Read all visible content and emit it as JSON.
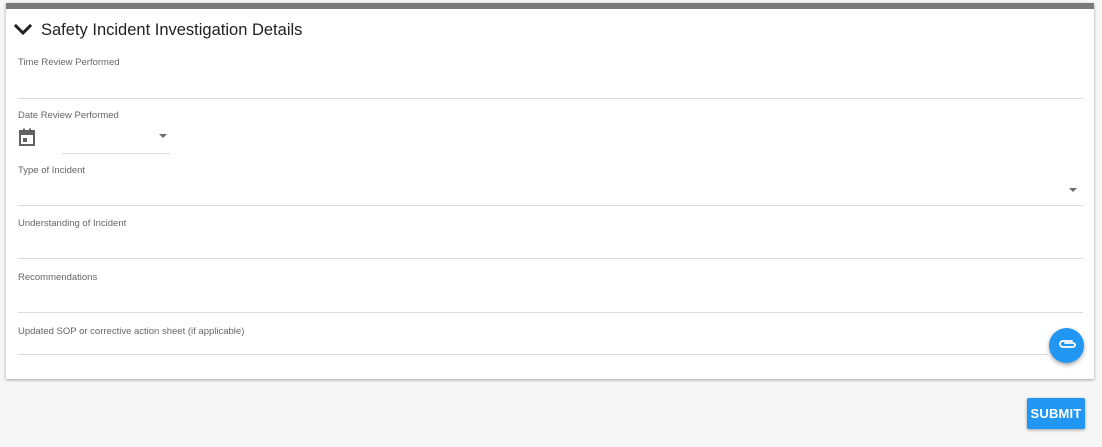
{
  "section": {
    "title": "Safety Incident Investigation Details",
    "expand_icon": "chevron-down-icon"
  },
  "fields": {
    "time_review": {
      "label": "Time Review Performed",
      "value": ""
    },
    "date_review": {
      "label": "Date Review Performed",
      "value": "",
      "icon": "calendar-icon"
    },
    "incident_type": {
      "label": "Type of Incident",
      "value": ""
    },
    "understanding": {
      "label": "Understanding of Incident",
      "value": ""
    },
    "recommendations": {
      "label": "Recommendations",
      "value": ""
    },
    "sop_attachment": {
      "label": "Updated SOP or corrective action sheet (if applicable)",
      "icon": "paperclip-icon"
    }
  },
  "actions": {
    "submit_label": "SUBMIT"
  },
  "colors": {
    "accent": "#2196f3",
    "header_bar": "#7a7a7a"
  }
}
